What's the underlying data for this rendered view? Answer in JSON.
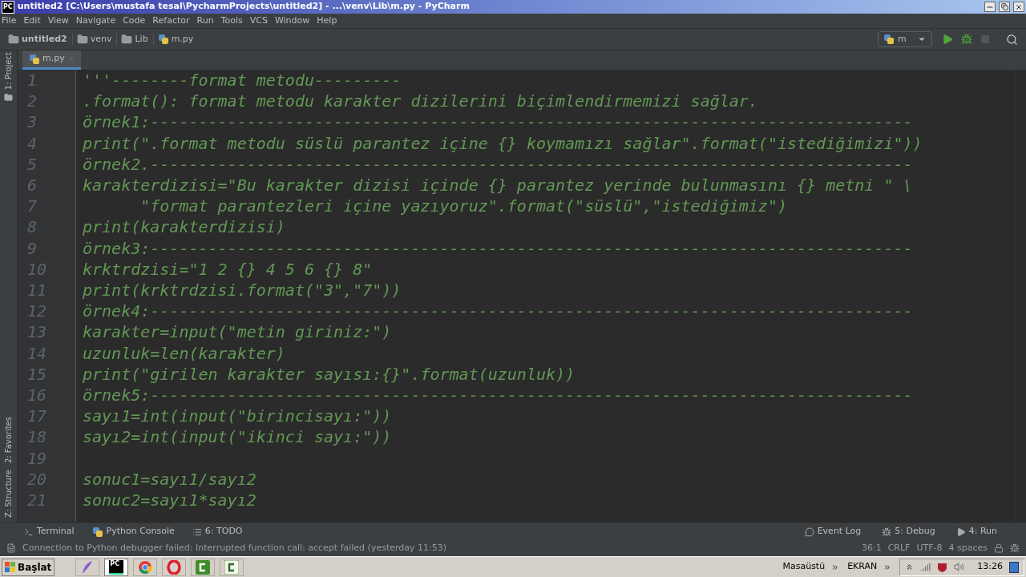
{
  "window": {
    "app_badge": "PC",
    "title": "untitled2 [C:\\Users\\mustafa tesal\\PycharmProjects\\untitled2] - ...\\venv\\Lib\\m.py - PyCharm"
  },
  "menu": [
    "File",
    "Edit",
    "View",
    "Navigate",
    "Code",
    "Refactor",
    "Run",
    "Tools",
    "VCS",
    "Window",
    "Help"
  ],
  "breadcrumbs": [
    {
      "label": "untitled2",
      "kind": "folder"
    },
    {
      "label": "venv",
      "kind": "folder"
    },
    {
      "label": "Lib",
      "kind": "folder"
    },
    {
      "label": "m.py",
      "kind": "python"
    }
  ],
  "run_config": "m",
  "side_tabs_top": [
    "1: Project"
  ],
  "side_tabs_bottom": [
    "2: Favorites",
    "Z: Structure"
  ],
  "editor_tabs": [
    {
      "label": "m.py",
      "selected": true
    }
  ],
  "code": [
    {
      "number": "1",
      "text": "'''--------format metodu---------"
    },
    {
      "number": "2",
      "text": ".format(): format metodu karakter dizilerini biçimlendirmemizi sağlar."
    },
    {
      "number": "3",
      "text": "örnek1:-------------------------------------------------------------------------------"
    },
    {
      "number": "4",
      "text": "print(\".format metodu süslü parantez içine {} koymamızı sağlar\".format(\"istediğimizi\"))"
    },
    {
      "number": "5",
      "text": "örnek2.-------------------------------------------------------------------------------"
    },
    {
      "number": "6",
      "text": "karakterdizisi=\"Bu karakter dizisi içinde {} parantez yerinde bulunmasını {} metni \" \\"
    },
    {
      "number": "7",
      "text": "      \"format parantezleri içine yazıyoruz\".format(\"süslü\",\"istediğimiz\")"
    },
    {
      "number": "8",
      "text": "print(karakterdizisi)"
    },
    {
      "number": "9",
      "text": "örnek3:-------------------------------------------------------------------------------"
    },
    {
      "number": "10",
      "text": "krktrdzisi=\"1 2 {} 4 5 6 {} 8\""
    },
    {
      "number": "11",
      "text": "print(krktrdzisi.format(\"3\",\"7\"))"
    },
    {
      "number": "12",
      "text": "örnek4:-------------------------------------------------------------------------------"
    },
    {
      "number": "13",
      "text": "karakter=input(\"metin giriniz:\")"
    },
    {
      "number": "14",
      "text": "uzunluk=len(karakter)"
    },
    {
      "number": "15",
      "text": "print(\"girilen karakter sayısı:{}\".format(uzunluk))"
    },
    {
      "number": "16",
      "text": "örnek5:-------------------------------------------------------------------------------"
    },
    {
      "number": "17",
      "text": "sayı1=int(input(\"birincisayı:\"))"
    },
    {
      "number": "18",
      "text": "sayı2=int(input(\"ikinci sayı:\"))"
    },
    {
      "number": "19"
    },
    {
      "number": "20",
      "text": "sonuc1=sayı1/sayı2"
    },
    {
      "number": "21",
      "text": "sonuc2=sayı1*sayı2"
    }
  ],
  "tool_windows_left": [
    {
      "label": "Terminal",
      "kind": "terminal"
    },
    {
      "label": "Python Console",
      "kind": "python"
    },
    {
      "label": "6: TODO",
      "kind": "list"
    }
  ],
  "tool_windows_right": [
    {
      "label": "Event Log",
      "kind": "log"
    },
    {
      "label": "5: Debug",
      "kind": "bug"
    },
    {
      "label": "4: Run",
      "kind": "play"
    }
  ],
  "status_bar": {
    "message": "Connection to Python debugger failed: Interrupted function call: accept failed (yesterday 11:53)",
    "position": "36:1",
    "line_separator": "CRLF",
    "encoding": "UTF-8",
    "indent": "4 spaces"
  },
  "taskbar": {
    "start": "Başlat",
    "apps": [
      {
        "kind": "feather",
        "selected": false
      },
      {
        "kind": "pycharm",
        "label": "PC",
        "selected": true
      },
      {
        "kind": "chrome",
        "selected": false
      },
      {
        "kind": "opera",
        "selected": false
      },
      {
        "kind": "camtasia",
        "selected": false
      },
      {
        "kind": "camtasia-light",
        "selected": false
      }
    ],
    "toolbars": [
      "Masaüstü",
      "EKRAN"
    ],
    "clock": "13:26"
  }
}
